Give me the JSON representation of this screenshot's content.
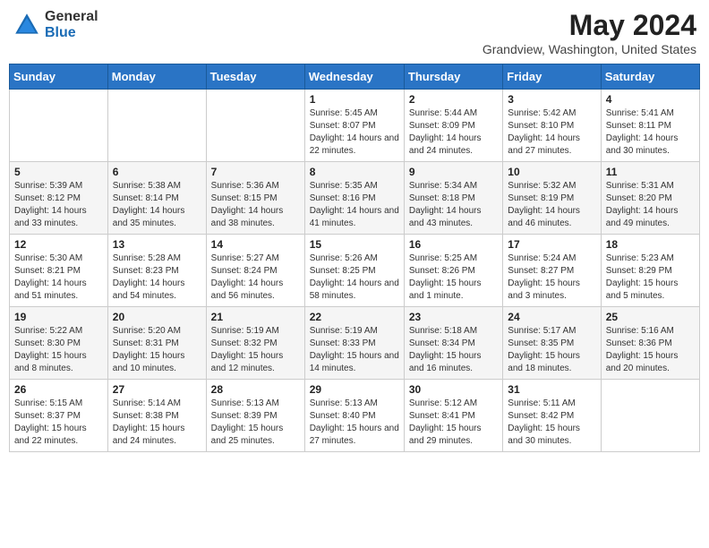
{
  "header": {
    "logo_general": "General",
    "logo_blue": "Blue",
    "month_title": "May 2024",
    "location": "Grandview, Washington, United States"
  },
  "days_of_week": [
    "Sunday",
    "Monday",
    "Tuesday",
    "Wednesday",
    "Thursday",
    "Friday",
    "Saturday"
  ],
  "weeks": [
    [
      {
        "day": "",
        "info": ""
      },
      {
        "day": "",
        "info": ""
      },
      {
        "day": "",
        "info": ""
      },
      {
        "day": "1",
        "info": "Sunrise: 5:45 AM\nSunset: 8:07 PM\nDaylight: 14 hours and 22 minutes."
      },
      {
        "day": "2",
        "info": "Sunrise: 5:44 AM\nSunset: 8:09 PM\nDaylight: 14 hours and 24 minutes."
      },
      {
        "day": "3",
        "info": "Sunrise: 5:42 AM\nSunset: 8:10 PM\nDaylight: 14 hours and 27 minutes."
      },
      {
        "day": "4",
        "info": "Sunrise: 5:41 AM\nSunset: 8:11 PM\nDaylight: 14 hours and 30 minutes."
      }
    ],
    [
      {
        "day": "5",
        "info": "Sunrise: 5:39 AM\nSunset: 8:12 PM\nDaylight: 14 hours and 33 minutes."
      },
      {
        "day": "6",
        "info": "Sunrise: 5:38 AM\nSunset: 8:14 PM\nDaylight: 14 hours and 35 minutes."
      },
      {
        "day": "7",
        "info": "Sunrise: 5:36 AM\nSunset: 8:15 PM\nDaylight: 14 hours and 38 minutes."
      },
      {
        "day": "8",
        "info": "Sunrise: 5:35 AM\nSunset: 8:16 PM\nDaylight: 14 hours and 41 minutes."
      },
      {
        "day": "9",
        "info": "Sunrise: 5:34 AM\nSunset: 8:18 PM\nDaylight: 14 hours and 43 minutes."
      },
      {
        "day": "10",
        "info": "Sunrise: 5:32 AM\nSunset: 8:19 PM\nDaylight: 14 hours and 46 minutes."
      },
      {
        "day": "11",
        "info": "Sunrise: 5:31 AM\nSunset: 8:20 PM\nDaylight: 14 hours and 49 minutes."
      }
    ],
    [
      {
        "day": "12",
        "info": "Sunrise: 5:30 AM\nSunset: 8:21 PM\nDaylight: 14 hours and 51 minutes."
      },
      {
        "day": "13",
        "info": "Sunrise: 5:28 AM\nSunset: 8:23 PM\nDaylight: 14 hours and 54 minutes."
      },
      {
        "day": "14",
        "info": "Sunrise: 5:27 AM\nSunset: 8:24 PM\nDaylight: 14 hours and 56 minutes."
      },
      {
        "day": "15",
        "info": "Sunrise: 5:26 AM\nSunset: 8:25 PM\nDaylight: 14 hours and 58 minutes."
      },
      {
        "day": "16",
        "info": "Sunrise: 5:25 AM\nSunset: 8:26 PM\nDaylight: 15 hours and 1 minute."
      },
      {
        "day": "17",
        "info": "Sunrise: 5:24 AM\nSunset: 8:27 PM\nDaylight: 15 hours and 3 minutes."
      },
      {
        "day": "18",
        "info": "Sunrise: 5:23 AM\nSunset: 8:29 PM\nDaylight: 15 hours and 5 minutes."
      }
    ],
    [
      {
        "day": "19",
        "info": "Sunrise: 5:22 AM\nSunset: 8:30 PM\nDaylight: 15 hours and 8 minutes."
      },
      {
        "day": "20",
        "info": "Sunrise: 5:20 AM\nSunset: 8:31 PM\nDaylight: 15 hours and 10 minutes."
      },
      {
        "day": "21",
        "info": "Sunrise: 5:19 AM\nSunset: 8:32 PM\nDaylight: 15 hours and 12 minutes."
      },
      {
        "day": "22",
        "info": "Sunrise: 5:19 AM\nSunset: 8:33 PM\nDaylight: 15 hours and 14 minutes."
      },
      {
        "day": "23",
        "info": "Sunrise: 5:18 AM\nSunset: 8:34 PM\nDaylight: 15 hours and 16 minutes."
      },
      {
        "day": "24",
        "info": "Sunrise: 5:17 AM\nSunset: 8:35 PM\nDaylight: 15 hours and 18 minutes."
      },
      {
        "day": "25",
        "info": "Sunrise: 5:16 AM\nSunset: 8:36 PM\nDaylight: 15 hours and 20 minutes."
      }
    ],
    [
      {
        "day": "26",
        "info": "Sunrise: 5:15 AM\nSunset: 8:37 PM\nDaylight: 15 hours and 22 minutes."
      },
      {
        "day": "27",
        "info": "Sunrise: 5:14 AM\nSunset: 8:38 PM\nDaylight: 15 hours and 24 minutes."
      },
      {
        "day": "28",
        "info": "Sunrise: 5:13 AM\nSunset: 8:39 PM\nDaylight: 15 hours and 25 minutes."
      },
      {
        "day": "29",
        "info": "Sunrise: 5:13 AM\nSunset: 8:40 PM\nDaylight: 15 hours and 27 minutes."
      },
      {
        "day": "30",
        "info": "Sunrise: 5:12 AM\nSunset: 8:41 PM\nDaylight: 15 hours and 29 minutes."
      },
      {
        "day": "31",
        "info": "Sunrise: 5:11 AM\nSunset: 8:42 PM\nDaylight: 15 hours and 30 minutes."
      },
      {
        "day": "",
        "info": ""
      }
    ]
  ]
}
